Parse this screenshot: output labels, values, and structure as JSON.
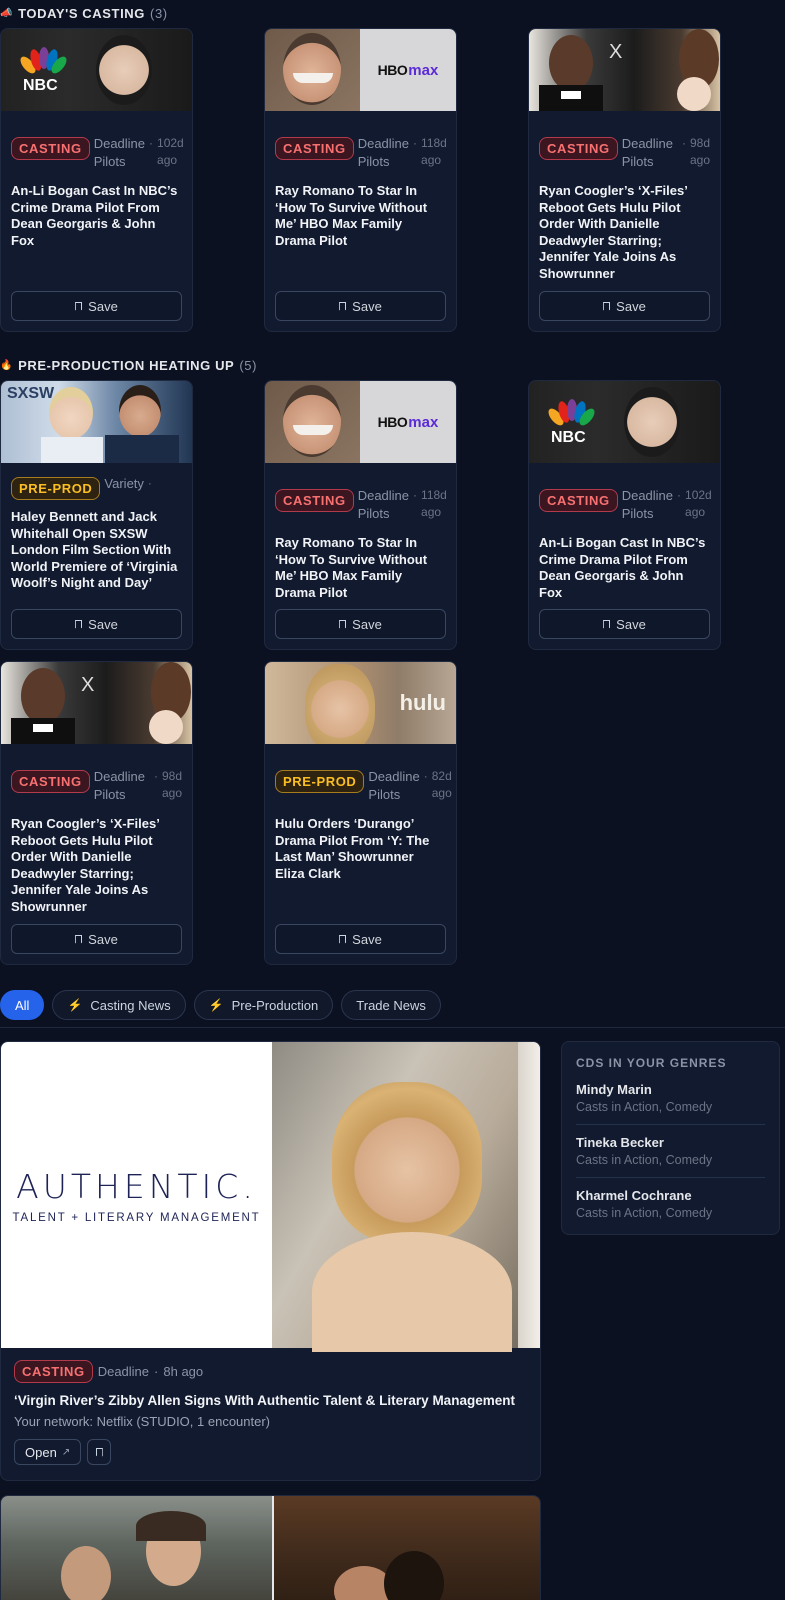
{
  "colors": {
    "background": "#0b1120",
    "card": "#111a2e",
    "casting": "#f87171",
    "preprod": "#fbbf24",
    "active_chip": "#2563eb"
  },
  "sections": {
    "today": {
      "title": "TODAY'S CASTING",
      "count": "(3)",
      "icon": "megaphone-icon"
    },
    "preprod": {
      "title": "PRE-PRODUCTION HEATING UP",
      "count": "(5)",
      "icon": "flame-icon"
    }
  },
  "today_cards": [
    {
      "thumb": "nbc",
      "badge": "CASTING",
      "source": "Deadline Pilots",
      "sep": "·",
      "ago": "102d ago",
      "title": "An-Li Bogan Cast In NBC’s Crime Drama Pilot From Dean Georgaris & John Fox",
      "save": "Save"
    },
    {
      "thumb": "hbomax",
      "badge": "CASTING",
      "source": "Deadline Pilots",
      "sep": "·",
      "ago": "118d ago",
      "title": "Ray Romano To Star In ‘How To Survive Without Me’ HBO Max Family Drama Pilot",
      "save": "Save"
    },
    {
      "thumb": "xfiles",
      "badge": "CASTING",
      "source": "Deadline Pilots",
      "sep": "·",
      "ago": "98d ago",
      "title": "Ryan Coogler’s ‘X-Files’ Reboot Gets Hulu Pilot Order With Danielle Deadwyler Starring; Jennifer Yale Joins As Showrunner",
      "save": "Save"
    }
  ],
  "preprod_cards": [
    {
      "thumb": "sxsw",
      "badge": "PRE-PROD",
      "source": "Variety",
      "sep": "·",
      "ago": "",
      "title": "Haley Bennett and Jack Whitehall Open SXSW London Film Section With World Premiere of ‘Virginia Woolf’s Night and Day’",
      "save": "Save"
    },
    {
      "thumb": "hbomax",
      "badge": "CASTING",
      "source": "Deadline Pilots",
      "sep": "·",
      "ago": "118d ago",
      "title": "Ray Romano To Star In ‘How To Survive Without Me’ HBO Max Family Drama Pilot",
      "save": "Save"
    },
    {
      "thumb": "nbc",
      "badge": "CASTING",
      "source": "Deadline Pilots",
      "sep": "·",
      "ago": "102d ago",
      "title": "An-Li Bogan Cast In NBC’s Crime Drama Pilot From Dean Georgaris & John Fox",
      "save": "Save"
    },
    {
      "thumb": "xfiles",
      "badge": "CASTING",
      "source": "Deadline Pilots",
      "sep": "·",
      "ago": "98d ago",
      "title": "Ryan Coogler’s ‘X-Files’ Reboot Gets Hulu Pilot Order With Danielle Deadwyler Starring; Jennifer Yale Joins As Showrunner",
      "save": "Save"
    },
    {
      "thumb": "hulu",
      "badge": "PRE-PROD",
      "source": "Deadline Pilots",
      "sep": "·",
      "ago": "82d ago",
      "title": "Hulu Orders ‘Durango’ Drama Pilot From ‘Y: The Last Man’ Showrunner Eliza Clark",
      "save": "Save"
    }
  ],
  "thumb_text": {
    "nbc": "NBC",
    "hbo": "HBO",
    "max": "max",
    "hulu": "hulu",
    "sxsw": "SXSW"
  },
  "filters": [
    {
      "label": "All",
      "active": true
    },
    {
      "label": "Casting News",
      "icon": "lightning-icon"
    },
    {
      "label": "Pre-Production",
      "icon": "lightning-icon"
    },
    {
      "label": "Trade News"
    }
  ],
  "feature": {
    "logo_main": "AUTHENTIC.",
    "logo_sub": "TALENT + LITERARY MANAGEMENT",
    "badge": "CASTING",
    "source": "Deadline",
    "sep": "·",
    "ago": "8h ago",
    "title": "‘Virgin River’s Zibby Allen Signs With Authentic Talent & Literary Management",
    "network": "Your network: Netflix (STUDIO, 1 encounter)",
    "open_label": "Open"
  },
  "sidebar": {
    "title": "CDS IN YOUR GENRES",
    "items": [
      {
        "name": "Mindy Marin",
        "genres": "Casts in Action, Comedy"
      },
      {
        "name": "Tineka Becker",
        "genres": "Casts in Action, Comedy"
      },
      {
        "name": "Kharmel Cochrane",
        "genres": "Casts in Action, Comedy"
      }
    ]
  }
}
